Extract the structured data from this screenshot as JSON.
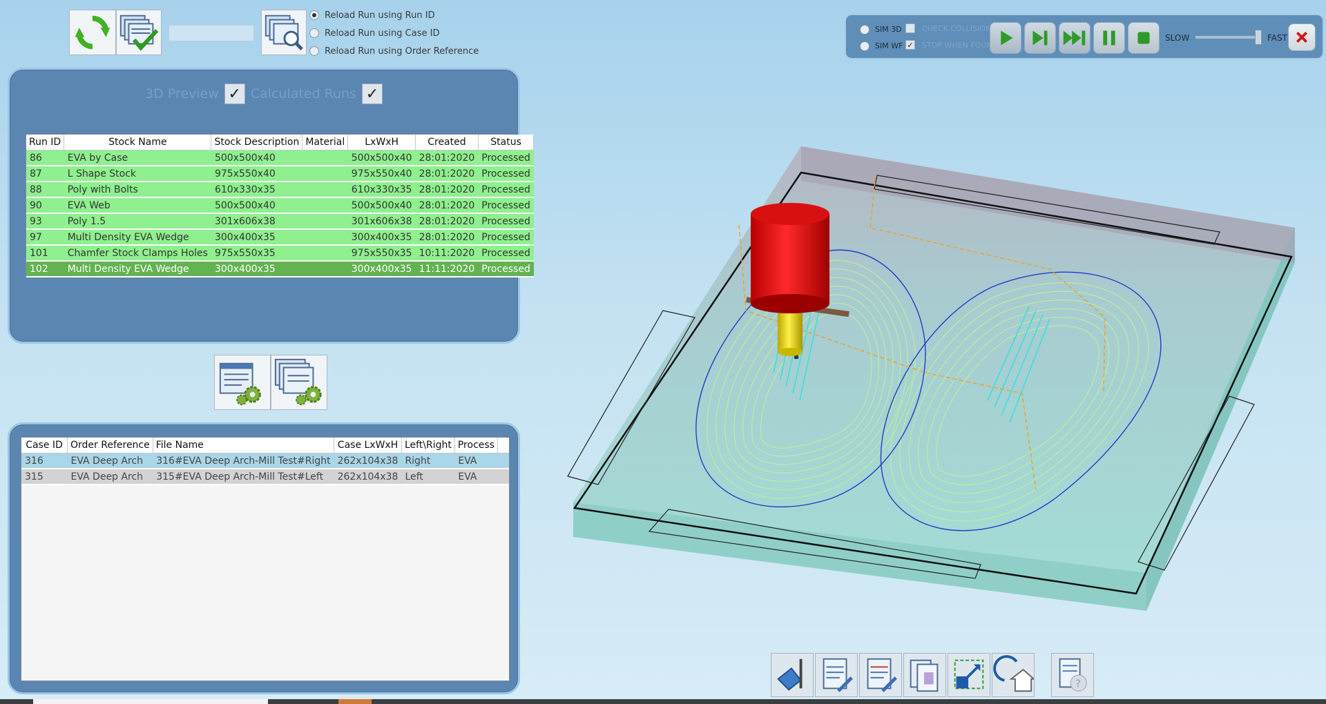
{
  "reload_options": [
    {
      "label": "Reload Run using Run ID",
      "selected": true
    },
    {
      "label": "Reload Run using Case ID",
      "selected": false
    },
    {
      "label": "Reload Run using Order Reference",
      "selected": false
    }
  ],
  "runid_input": {
    "value": ""
  },
  "runs_panel": {
    "preview_label": "3D Preview",
    "preview_checked": true,
    "calculated_label": "Calculated Runs",
    "calculated_checked": true,
    "columns": [
      "Run ID",
      "Stock Name",
      "Stock Description",
      "Material",
      "LxWxH",
      "Created",
      "Status"
    ],
    "rows": [
      {
        "run_id": "86",
        "stock_name": "EVA by Case",
        "stock_description": "500x500x40",
        "material": "",
        "lxwxh": "500x500x40",
        "created": "28:01:2020",
        "status": "Processed"
      },
      {
        "run_id": "87",
        "stock_name": "L Shape Stock",
        "stock_description": "975x550x40",
        "material": "",
        "lxwxh": "975x550x40",
        "created": "28:01:2020",
        "status": "Processed"
      },
      {
        "run_id": "88",
        "stock_name": "Poly with Bolts",
        "stock_description": "610x330x35",
        "material": "",
        "lxwxh": "610x330x35",
        "created": "28:01:2020",
        "status": "Processed"
      },
      {
        "run_id": "90",
        "stock_name": "EVA Web",
        "stock_description": "500x500x40",
        "material": "",
        "lxwxh": "500x500x40",
        "created": "28:01:2020",
        "status": "Processed"
      },
      {
        "run_id": "93",
        "stock_name": "Poly 1.5",
        "stock_description": "301x606x38",
        "material": "",
        "lxwxh": "301x606x38",
        "created": "28:01:2020",
        "status": "Processed"
      },
      {
        "run_id": "97",
        "stock_name": "Multi Density EVA Wedge",
        "stock_description": "300x400x35",
        "material": "",
        "lxwxh": "300x400x35",
        "created": "28:01:2020",
        "status": "Processed"
      },
      {
        "run_id": "101",
        "stock_name": "Chamfer Stock Clamps Holes",
        "stock_description": "975x550x35",
        "material": "",
        "lxwxh": "975x550x35",
        "created": "10:11:2020",
        "status": "Processed"
      },
      {
        "run_id": "102",
        "stock_name": "Multi Density EVA Wedge",
        "stock_description": "300x400x35",
        "material": "",
        "lxwxh": "300x400x35",
        "created": "11:11:2020",
        "status": "Processed"
      }
    ],
    "selected_index": 7
  },
  "cases_panel": {
    "columns": [
      "Case ID",
      "Order Reference",
      "File Name",
      "Case LxWxH",
      "Left\\Right",
      "Process"
    ],
    "rows": [
      {
        "case_id": "316",
        "order_reference": "EVA Deep Arch",
        "file_name": "316#EVA Deep Arch-Mill Test#Right",
        "case_lxwxh": "262x104x38",
        "left_right": "Right",
        "process": "EVA"
      },
      {
        "case_id": "315",
        "order_reference": "EVA Deep Arch",
        "file_name": "315#EVA Deep Arch-Mill Test#Left",
        "case_lxwxh": "262x104x38",
        "left_right": "Left",
        "process": "EVA"
      }
    ]
  },
  "sim_toolbar": {
    "sim3d_label": "SIM 3D",
    "simwf_label": "SIM WF",
    "check_collisions_label": "CHECK COLLISIONS",
    "check_collisions_checked": false,
    "stop_when_found_label": "STOP WHEN FOUND",
    "stop_when_found_checked": true,
    "slow_label": "SLOW",
    "fast_label": "FAST",
    "speed_value": 0.97
  },
  "icons": {
    "refresh": "refresh-icon",
    "calculate": "calculate-runs-icon",
    "search_run": "search-run-icon",
    "run_settings": "run-settings-icon",
    "multi_settings": "multi-run-settings-icon",
    "probe": "probe-tool-icon",
    "nc_edit": "nc-edit-icon",
    "nc_edit2": "nc-edit-alt-icon",
    "report": "report-icon",
    "fit_view": "fit-view-icon",
    "home_view": "home-view-icon",
    "help": "help-icon"
  },
  "colors": {
    "panel_bg": "#5b86b1",
    "row_green": "#8ef08e",
    "row_selected": "#63b352",
    "cutter_head": "#e00000",
    "tool_shank": "#e6d800",
    "toolpath_green": "#b8f0a0",
    "toolpath_cyan": "#37e0e0",
    "stock_cyan": "#9fd9d3"
  }
}
